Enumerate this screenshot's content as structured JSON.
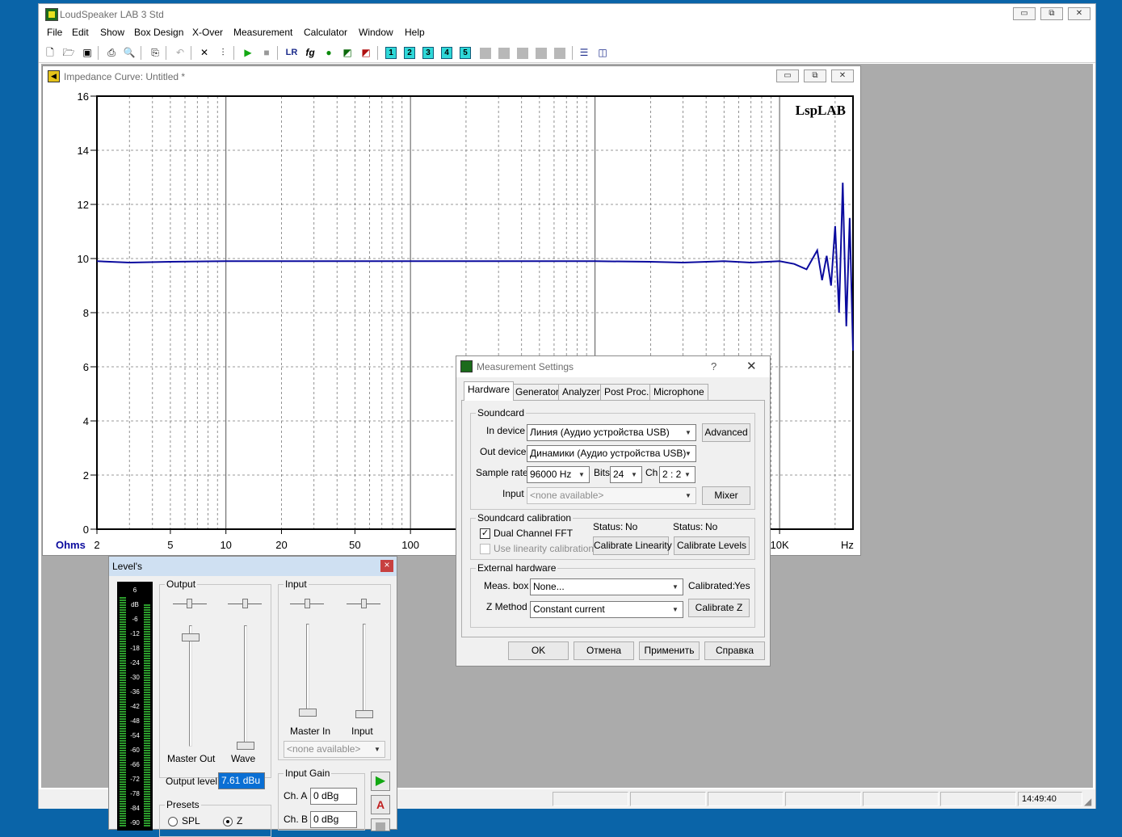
{
  "app": {
    "title": "LoudSpeaker LAB 3 Std",
    "window_buttons": {
      "minimize": "▭",
      "restore": "⧉",
      "close": "✕"
    },
    "menu": [
      "File",
      "Edit",
      "Show",
      "Box Design",
      "X-Over",
      "Measurement",
      "Calculator",
      "Window",
      "Help"
    ],
    "toolbar_numbers": [
      "1",
      "2",
      "3",
      "4",
      "5"
    ],
    "toolbar_text": {
      "lr": "LR",
      "fg": "fg"
    },
    "status_time": "14:49:40"
  },
  "impedance": {
    "title": "Impedance Curve: Untitled *",
    "logo": "LspLAB",
    "colors": {
      "curve": "#0b0b9e",
      "axis_labels": "#0b0b9e"
    }
  },
  "chart_data": {
    "type": "line",
    "ylabel": "Ohms",
    "xlabel": "Hz",
    "x_scale": "log",
    "xlim": [
      2,
      25000
    ],
    "ylim": [
      0,
      16
    ],
    "y_ticks": [
      0,
      2,
      4,
      6,
      8,
      10,
      12,
      14,
      16
    ],
    "x_tick_labels": [
      {
        "value": 2,
        "label": "2"
      },
      {
        "value": 5,
        "label": "5"
      },
      {
        "value": 10,
        "label": "10"
      },
      {
        "value": 20,
        "label": "20"
      },
      {
        "value": 50,
        "label": "50"
      },
      {
        "value": 100,
        "label": "100"
      },
      {
        "value": 10000,
        "label": "10K"
      }
    ],
    "grid": true,
    "series": [
      {
        "x": [
          2,
          3,
          5,
          10,
          20,
          50,
          100,
          200,
          500,
          1000,
          2000,
          3000,
          5000,
          7000,
          10000,
          12000,
          14000,
          16000,
          17000,
          18000,
          19000,
          20000,
          21000,
          22000,
          23000,
          24000,
          25000
        ],
        "y": [
          9.9,
          9.85,
          9.88,
          9.9,
          9.9,
          9.9,
          9.9,
          9.9,
          9.9,
          9.9,
          9.88,
          9.85,
          9.9,
          9.85,
          9.9,
          9.8,
          9.6,
          10.3,
          9.2,
          10.1,
          9.0,
          11.2,
          8.0,
          12.8,
          7.5,
          11.5,
          6.6
        ]
      }
    ]
  },
  "levels": {
    "title": "Level's",
    "close": "×",
    "vu_labels": [
      "6",
      "dB",
      "-6",
      "-12",
      "-18",
      "-24",
      "-30",
      "-36",
      "-42",
      "-48",
      "-54",
      "-60",
      "-66",
      "-72",
      "-78",
      "-84",
      "-90"
    ],
    "vu_level_left": 0.95,
    "vu_level_right": 0.92,
    "output_group": "Output",
    "master_out": "Master Out",
    "wave": "Wave",
    "output_level_label": "Output level",
    "output_level_value": "7.61 dBu",
    "input_group": "Input",
    "master_in": "Master In",
    "input": "Input",
    "input_select": "<none available>",
    "input_gain_group": "Input Gain",
    "ch_a_label": "Ch. A",
    "ch_a_value": "0 dBg",
    "ch_b_label": "Ch. B",
    "ch_b_value": "0 dBg",
    "presets_group": "Presets",
    "preset_spl": "SPL",
    "preset_z": "Z",
    "preset_selected": "Z"
  },
  "settings": {
    "title": "Measurement Settings",
    "help_button": "?",
    "close_button": "✕",
    "tabs": [
      "Hardware",
      "Generator",
      "Analyzer",
      "Post Proc.",
      "Microphone"
    ],
    "active_tab": "Hardware",
    "soundcard_group": "Soundcard",
    "in_device_label": "In device",
    "in_device_value": "Линия (Аудио устройства USB)",
    "out_device_label": "Out device",
    "out_device_value": "Динамики (Аудио устройства USB)",
    "sample_rate_label": "Sample rate",
    "sample_rate_value": "96000 Hz",
    "bits_label": "Bits",
    "bits_value": "24",
    "ch_label": "Ch",
    "ch_value": "2 : 2",
    "input_label": "Input",
    "input_value": "<none available>",
    "advanced_button": "Advanced",
    "mixer_button": "Mixer",
    "calibration_group": "Soundcard calibration",
    "status_label_1": "Status:",
    "status_value_1": "No",
    "status_label_2": "Status:",
    "status_value_2": "No",
    "dual_channel": "Dual Channel FFT",
    "dual_channel_checked": true,
    "use_linearity": "Use linearity calibration",
    "use_linearity_checked": false,
    "calibrate_linearity": "Calibrate Linearity",
    "calibrate_levels": "Calibrate Levels",
    "external_group": "External hardware",
    "meas_box_label": "Meas. box",
    "meas_box_value": "None...",
    "calibrated_label": "Calibrated:",
    "calibrated_value": "Yes",
    "z_method_label": "Z Method",
    "z_method_value": "Constant current",
    "calibrate_z": "Calibrate Z",
    "ok": "OK",
    "cancel": "Отмена",
    "apply": "Применить",
    "help": "Справка"
  }
}
